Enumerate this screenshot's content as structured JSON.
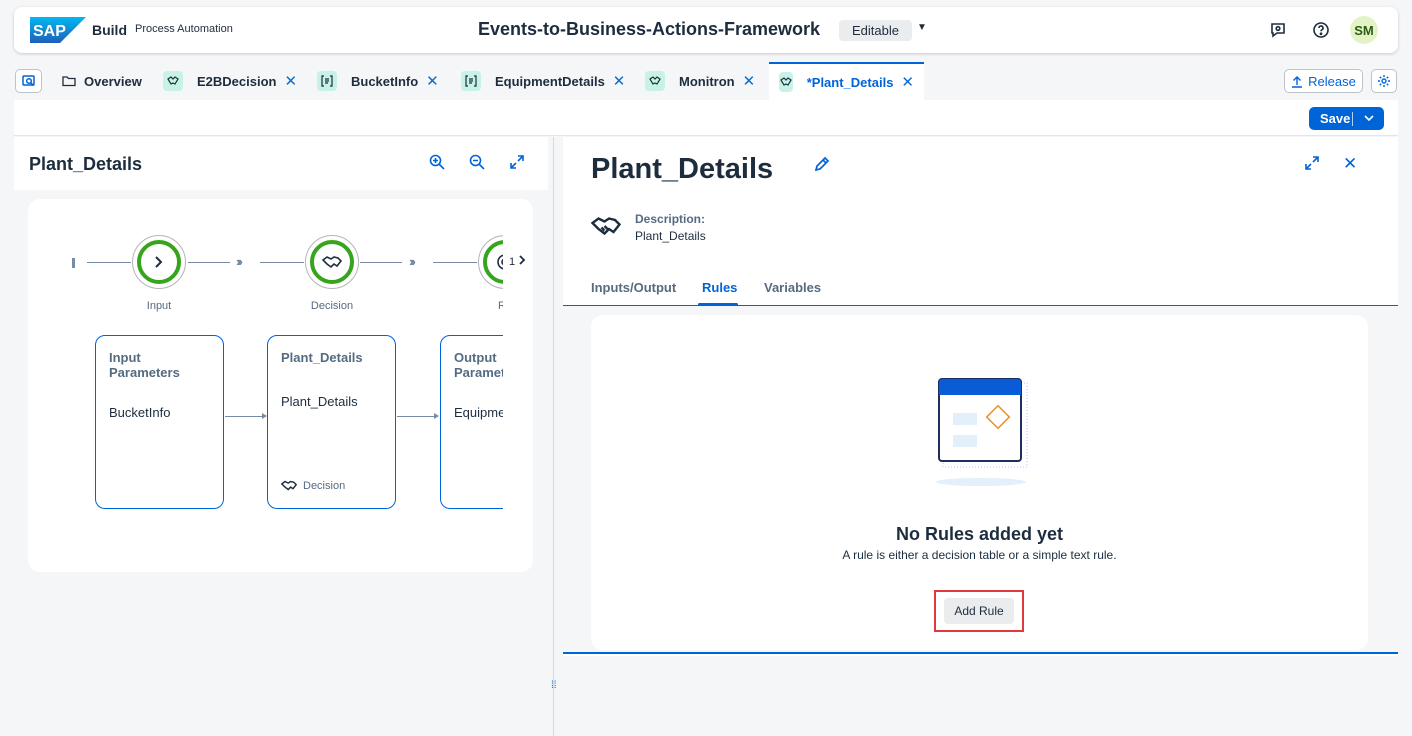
{
  "shell": {
    "logo_text": "SAP",
    "build": "Build",
    "product": "Process Automation",
    "project_title": "Events-to-Business-Actions-Framework",
    "status": "Editable",
    "avatar_initials": "SM"
  },
  "tabs": [
    {
      "label": "Overview",
      "icon": "folder-icon",
      "closable": false
    },
    {
      "label": "E2BDecision",
      "icon": "decision-icon",
      "closable": true
    },
    {
      "label": "BucketInfo",
      "icon": "data-type-icon",
      "closable": true
    },
    {
      "label": "EquipmentDetails",
      "icon": "data-type-icon",
      "closable": true
    },
    {
      "label": "Monitron",
      "icon": "decision-icon",
      "closable": true
    },
    {
      "label": "*Plant_Details",
      "icon": "decision-icon",
      "closable": true,
      "active": true
    }
  ],
  "tab_close_glyph": "✕",
  "header_actions": {
    "release": "Release"
  },
  "toolbar": {
    "save": "Save"
  },
  "left": {
    "title": "Plant_Details",
    "flow": {
      "nodes": [
        {
          "label": "Input"
        },
        {
          "label": "Decision"
        },
        {
          "label": "Re"
        }
      ],
      "overflow_count": "1",
      "boxes": [
        {
          "title": "Input Parameters",
          "value": "BucketInfo"
        },
        {
          "title": "Plant_Details",
          "value": "Plant_Details",
          "footer": "Decision"
        },
        {
          "title": "Output Paramet",
          "value": "Equipme"
        }
      ]
    }
  },
  "right": {
    "title": "Plant_Details",
    "description_label": "Description:",
    "description_value": "Plant_Details",
    "tabs": [
      "Inputs/Output",
      "Rules",
      "Variables"
    ],
    "active_tab": "Rules",
    "empty_title": "No Rules added yet",
    "empty_subtitle": "A rule is either a decision table or a simple text rule.",
    "add_rule": "Add Rule"
  },
  "colors": {
    "accent": "#0064d9",
    "node_ring": "#36a41d",
    "highlight": "#e0393e"
  }
}
